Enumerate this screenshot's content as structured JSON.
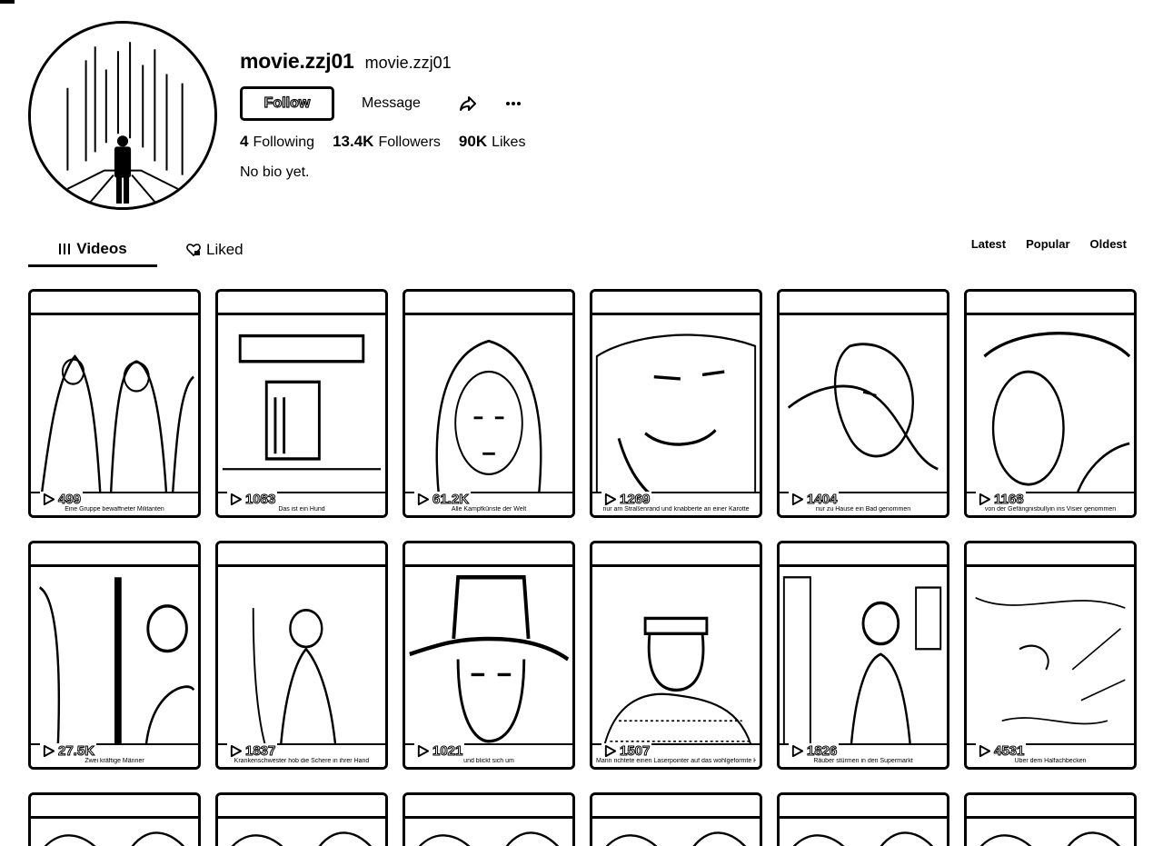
{
  "profile": {
    "display_name": "movie.zzj01",
    "username": "movie.zzj01",
    "follow_label": "Follow",
    "message_label": "Message",
    "bio": "No bio yet.",
    "stats": [
      {
        "value": "4",
        "label": "Following"
      },
      {
        "value": "13.4K",
        "label": "Followers"
      },
      {
        "value": "90K",
        "label": "Likes"
      }
    ]
  },
  "tabs": [
    {
      "label": "Videos",
      "icon": "grid-icon",
      "active": true
    },
    {
      "label": "Liked",
      "icon": "heart-lock-icon",
      "active": false
    }
  ],
  "sort": [
    "Latest",
    "Popular",
    "Oldest"
  ],
  "videos": [
    {
      "views": "499",
      "caption": "Eine Gruppe bewaffneter Militanten"
    },
    {
      "views": "1083",
      "caption": "Das ist ein Hund"
    },
    {
      "views": "61.2K",
      "caption": "Alle Kampfkünste der Welt"
    },
    {
      "views": "1269",
      "caption": "nur am Straßenrand und knabberte an einer Karotte"
    },
    {
      "views": "1404",
      "caption": "nur zu Hause ein Bad genommen"
    },
    {
      "views": "1168",
      "caption": "von der Gefängnisbullyin ins Visier genommen"
    },
    {
      "views": "27.5K",
      "caption": "Zwei kräftige Männer"
    },
    {
      "views": "1837",
      "caption": "Krankenschwester hob die Schere in ihrer Hand"
    },
    {
      "views": "1021",
      "caption": "und blickt sich um"
    },
    {
      "views": "1507",
      "caption": "Mann richtete einen Laserpointer auf das wohlgeformte Hinterteil einer Schwimmerin"
    },
    {
      "views": "1826",
      "caption": "Räuber stürmen in den Supermarkt"
    },
    {
      "views": "4531",
      "caption": "Über dem Halfachbecken"
    }
  ],
  "colors": {
    "ink": "#000000",
    "paper": "#ffffff"
  }
}
